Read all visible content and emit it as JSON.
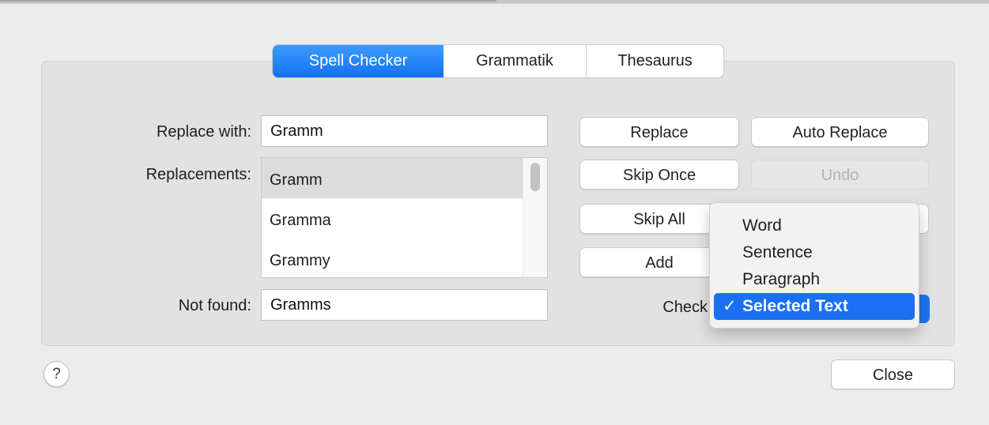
{
  "tabs": [
    {
      "label": "Spell Checker",
      "active": true
    },
    {
      "label": "Grammatik",
      "active": false
    },
    {
      "label": "Thesaurus",
      "active": false
    }
  ],
  "replace_with": {
    "label": "Replace with:",
    "value": "Gramm"
  },
  "replacements": {
    "label": "Replacements:",
    "items": [
      "Gramm",
      "Gramma",
      "Grammy"
    ],
    "selected": "Gramm"
  },
  "not_found": {
    "label": "Not found:",
    "value": "Gramms"
  },
  "buttons": {
    "replace": "Replace",
    "auto_replace": "Auto Replace",
    "skip_once": "Skip Once",
    "undo": "Undo",
    "skip_all": "Skip All",
    "add": "Add",
    "close": "Close"
  },
  "check": {
    "label": "Check",
    "selected": "Selected Text",
    "menu": [
      {
        "label": "Word",
        "checked": false
      },
      {
        "label": "Sentence",
        "checked": false
      },
      {
        "label": "Paragraph",
        "checked": false
      },
      {
        "label": "Selected Text",
        "checked": true
      }
    ],
    "check_mark": "✓"
  },
  "help": {
    "glyph": "?",
    "icon": "help-icon"
  },
  "colors": {
    "accent": "#1b6ff2",
    "window_bg": "#ececec",
    "panel_bg": "#e2e2e2"
  }
}
